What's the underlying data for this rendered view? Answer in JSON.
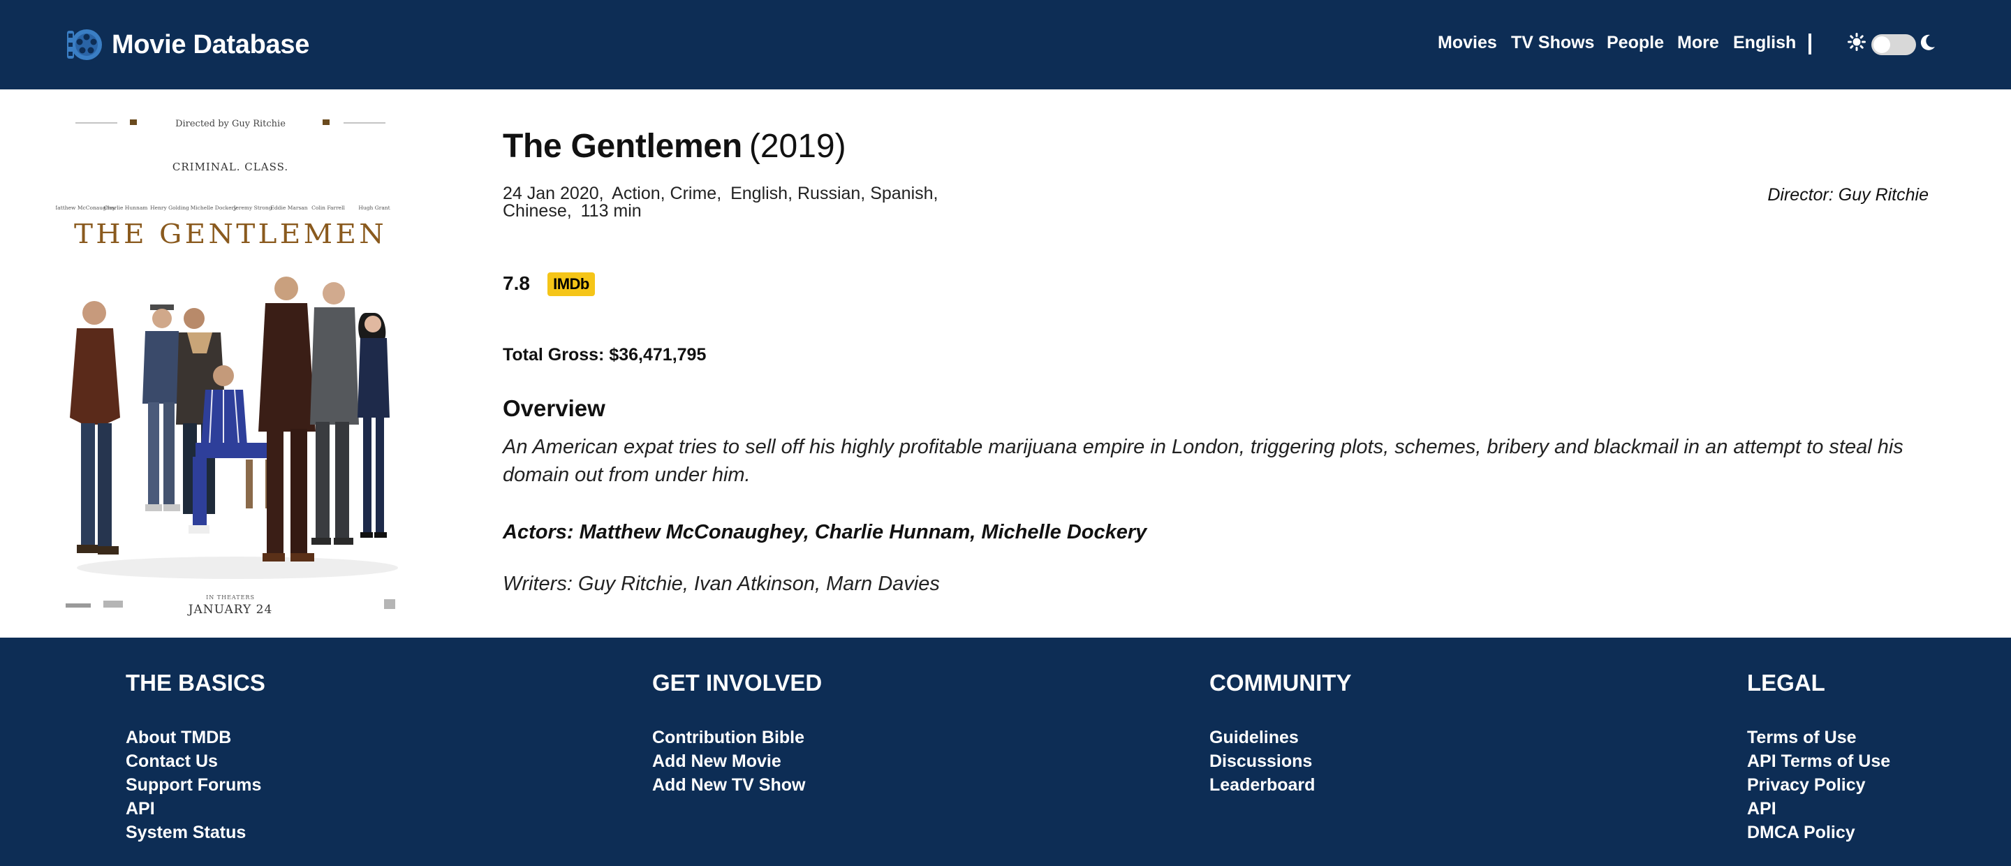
{
  "brand": {
    "name": "Movie Database",
    "logo_icon": "film-reel-icon"
  },
  "nav": {
    "items": [
      "Movies",
      "TV Shows",
      "People",
      "More",
      "English"
    ],
    "separator": "|",
    "theme_icons": [
      "sun-icon",
      "moon-icon"
    ]
  },
  "colors": {
    "header_bg": "#0d2d55",
    "imdb_yellow": "#f5c518",
    "toggle_track": "#d8d8d8"
  },
  "poster": {
    "directed_by": "Directed by Guy Ritchie",
    "tagline": "CRIMINAL. CLASS.",
    "cast_names": [
      "Matthew McConaughey",
      "Charlie Hunnam",
      "Henry Golding",
      "Michelle Dockery",
      "Jeremy Strong",
      "Eddie Marsan",
      "Colin Farrell",
      "Hugh Grant"
    ],
    "poster_title": "THE GENTLEMEN",
    "in_theaters": "IN THEATERS",
    "release": "JANUARY 24"
  },
  "movie": {
    "title": "The Gentlemen",
    "year": "(2019)",
    "release_date": "24 Jan 2020,",
    "genres": "Action, Crime,",
    "languages": "English, Russian, Spanish, Chinese,",
    "runtime": "113 min",
    "director": "Director: Guy Ritchie",
    "rating": "7.8",
    "rating_source": "IMDb",
    "gross": "Total Gross: $36,471,795",
    "overview_heading": "Overview",
    "overview": "An American expat tries to sell off his highly profitable marijuana empire in London, triggering plots, schemes, bribery and blackmail in an attempt to steal his domain out from under him.",
    "actors": "Actors: Matthew McConaughey, Charlie Hunnam, Michelle Dockery",
    "writers": "Writers: Guy Ritchie, Ivan Atkinson, Marn Davies"
  },
  "footer": {
    "columns": [
      {
        "heading": "THE BASICS",
        "links": [
          "About TMDB",
          "Contact Us",
          "Support Forums",
          "API",
          "System Status"
        ]
      },
      {
        "heading": "GET INVOLVED",
        "links": [
          "Contribution Bible",
          "Add New Movie",
          "Add New TV Show"
        ]
      },
      {
        "heading": "COMMUNITY",
        "links": [
          "Guidelines",
          "Discussions",
          "Leaderboard"
        ]
      },
      {
        "heading": "LEGAL",
        "links": [
          "Terms of Use",
          "API Terms of Use",
          "Privacy Policy",
          "API",
          "DMCA Policy"
        ]
      }
    ]
  }
}
